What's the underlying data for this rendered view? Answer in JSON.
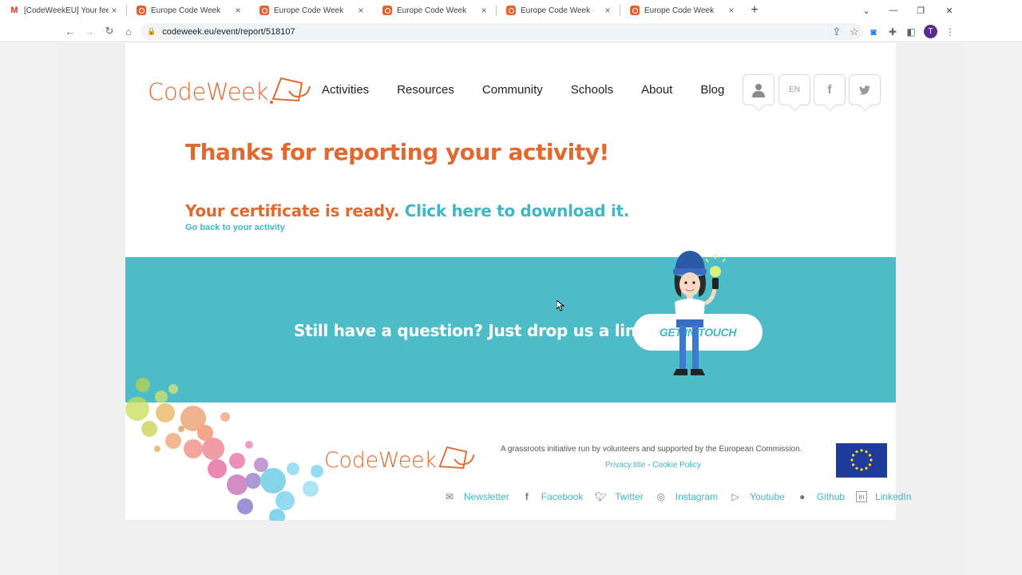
{
  "browser": {
    "tabs": [
      {
        "title": "[CodeWeekEU] Your feedb",
        "icon": "gmail-icon"
      },
      {
        "title": "Europe Code Week",
        "icon": "codeweek-favicon"
      },
      {
        "title": "Europe Code Week",
        "icon": "codeweek-favicon"
      },
      {
        "title": "Europe Code Week",
        "icon": "codeweek-favicon"
      },
      {
        "title": "Europe Code Week",
        "icon": "codeweek-favicon"
      },
      {
        "title": "Europe Code Week",
        "icon": "codeweek-favicon"
      }
    ],
    "active_tab": 2,
    "url": "codeweek.eu/event/report/518107",
    "profile_initial": "T"
  },
  "header": {
    "logo_text": "CodeWeek",
    "nav": [
      "Activities",
      "Resources",
      "Community",
      "Schools",
      "About",
      "Blog"
    ],
    "lang": "EN"
  },
  "main": {
    "heading": "Thanks for reporting your activity!",
    "cert_text": "Your certificate is ready.",
    "cert_link": "Click here to download it.",
    "back_link": "Go back to your activity"
  },
  "banner": {
    "text": "Still have a question? Just drop us a line!",
    "button": "GET IN TOUCH"
  },
  "footer": {
    "logo_text": "CodeWeek",
    "tagline": "A grassroots initiative run by volunteers and supported by the European Commission.",
    "privacy": "Privacy.title",
    "separator": " - ",
    "cookie": "Cookie Policy",
    "social": [
      {
        "label": "Newsletter",
        "icon": "mail-icon"
      },
      {
        "label": "Facebook",
        "icon": "facebook-icon"
      },
      {
        "label": "Twitter",
        "icon": "twitter-icon"
      },
      {
        "label": "Instagram",
        "icon": "instagram-icon"
      },
      {
        "label": "Youtube",
        "icon": "youtube-icon"
      },
      {
        "label": "Github",
        "icon": "github-icon"
      },
      {
        "label": "LinkedIn",
        "icon": "linkedin-icon"
      }
    ]
  },
  "colors": {
    "brand_orange": "#e1692f",
    "brand_teal": "#3fb7c4",
    "banner": "#4dbcc8"
  }
}
